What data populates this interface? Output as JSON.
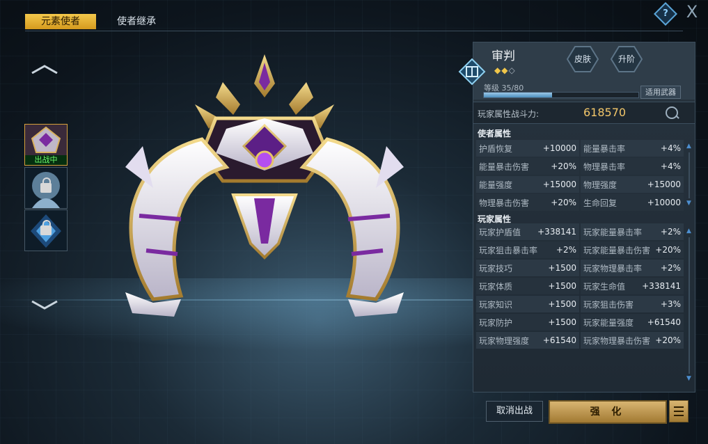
{
  "tabs": [
    {
      "label": "元素使者",
      "active": true
    },
    {
      "label": "使者继承",
      "active": false
    }
  ],
  "top_icons": {
    "help": "?",
    "close": "X"
  },
  "left_slots": [
    {
      "status": "出战中",
      "locked": false
    },
    {
      "status": "",
      "locked": true
    },
    {
      "status": "",
      "locked": true
    }
  ],
  "panel": {
    "name": "审判",
    "stars": {
      "filled": 2,
      "total": 3
    },
    "skin_button": "皮肤",
    "upgrade_button": "升阶",
    "level_label": "等级",
    "level_value": "35/80",
    "level_progress": 0.44,
    "weapon_button": "适用武器",
    "power_label": "玩家属性战斗力:",
    "power_value": "618570"
  },
  "envoy_section": {
    "title": "使者属性",
    "rows": [
      [
        {
          "k": "护盾恢复",
          "v": "+10000"
        },
        {
          "k": "能量暴击率",
          "v": "+4%"
        }
      ],
      [
        {
          "k": "能量暴击伤害",
          "v": "+20%"
        },
        {
          "k": "物理暴击率",
          "v": "+4%"
        }
      ],
      [
        {
          "k": "能量强度",
          "v": "+15000"
        },
        {
          "k": "物理强度",
          "v": "+15000"
        }
      ],
      [
        {
          "k": "物理暴击伤害",
          "v": "+20%"
        },
        {
          "k": "生命回复",
          "v": "+10000"
        }
      ]
    ]
  },
  "player_section": {
    "title": "玩家属性",
    "rows": [
      [
        {
          "k": "玩家护盾值",
          "v": "+338141"
        },
        {
          "k": "玩家能量暴击率",
          "v": "+2%"
        }
      ],
      [
        {
          "k": "玩家狙击暴击率",
          "v": "+2%"
        },
        {
          "k": "玩家能量暴击伤害",
          "v": "+20%"
        }
      ],
      [
        {
          "k": "玩家技巧",
          "v": "+1500"
        },
        {
          "k": "玩家物理暴击率",
          "v": "+2%"
        }
      ],
      [
        {
          "k": "玩家体质",
          "v": "+1500"
        },
        {
          "k": "玩家生命值",
          "v": "+338141"
        }
      ],
      [
        {
          "k": "玩家知识",
          "v": "+1500"
        },
        {
          "k": "玩家狙击伤害",
          "v": "+3%"
        }
      ],
      [
        {
          "k": "玩家防护",
          "v": "+1500"
        },
        {
          "k": "玩家能量强度",
          "v": "+61540"
        }
      ],
      [
        {
          "k": "玩家物理强度",
          "v": "+61540"
        },
        {
          "k": "玩家物理暴击伤害",
          "v": "+20%"
        }
      ]
    ]
  },
  "buttons": {
    "cancel": "取消出战",
    "enhance": "强 化",
    "menu_icon": "list-icon"
  },
  "colors": {
    "tab_active": "#e8b332",
    "gold": "#f3c76a",
    "creature_purple": "#7a2aa0",
    "creature_gold": "#d7b25a"
  }
}
